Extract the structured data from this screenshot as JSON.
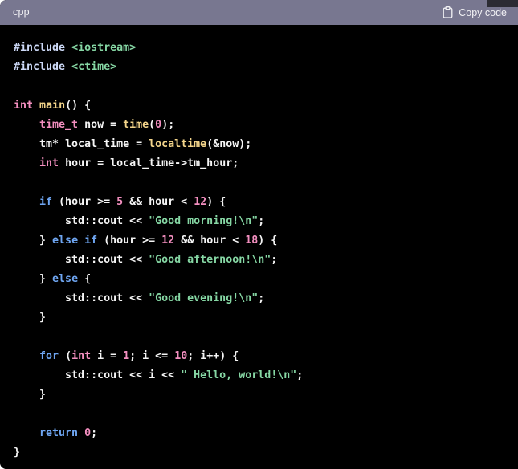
{
  "header": {
    "language_label": "cpp",
    "copy_label": "Copy code",
    "copy_icon": "clipboard-icon",
    "background_color": "#787790",
    "text_color": "#f2f2f5"
  },
  "editor": {
    "background_color": "#000000",
    "default_text_color": "#f5f5f5",
    "language": "cpp",
    "font_size_px": 13.3,
    "line_height_px": 24,
    "line_count": 22
  },
  "theme": {
    "preprocessor": "#cdd9f7",
    "include_path": "#86d7a4",
    "string": "#86d7a4",
    "type": "#f48fc0",
    "number": "#f48fc0",
    "function": "#f3d48a",
    "keyword": "#6fa6f2",
    "plain": "#f5f5f5"
  },
  "code": {
    "plain_text": "#include <iostream>\n#include <ctime>\n\nint main() {\n    time_t now = time(0);\n    tm* local_time = localtime(&now);\n    int hour = local_time->tm_hour;\n\n    if (hour >= 5 && hour < 12) {\n        std::cout << \"Good morning!\\n\";\n    } else if (hour >= 12 && hour < 18) {\n        std::cout << \"Good afternoon!\\n\";\n    } else {\n        std::cout << \"Good evening!\\n\";\n    }\n\n    for (int i = 1; i <= 10; i++) {\n        std::cout << i << \" Hello, world!\\n\";\n    }\n\n    return 0;\n}",
    "lines": [
      {
        "n": 1,
        "tokens": [
          {
            "t": "#include",
            "c": "pre"
          },
          {
            "t": " ",
            "c": "plain"
          },
          {
            "t": "<iostream>",
            "c": "inc"
          }
        ]
      },
      {
        "n": 2,
        "tokens": [
          {
            "t": "#include",
            "c": "pre"
          },
          {
            "t": " ",
            "c": "plain"
          },
          {
            "t": "<ctime>",
            "c": "inc"
          }
        ]
      },
      {
        "n": 3,
        "tokens": []
      },
      {
        "n": 4,
        "tokens": [
          {
            "t": "int",
            "c": "type"
          },
          {
            "t": " ",
            "c": "plain"
          },
          {
            "t": "main",
            "c": "fn"
          },
          {
            "t": "() {",
            "c": "plain"
          }
        ]
      },
      {
        "n": 5,
        "tokens": [
          {
            "t": "    ",
            "c": "plain"
          },
          {
            "t": "time_t",
            "c": "type"
          },
          {
            "t": " now = ",
            "c": "plain"
          },
          {
            "t": "time",
            "c": "fn"
          },
          {
            "t": "(",
            "c": "plain"
          },
          {
            "t": "0",
            "c": "num"
          },
          {
            "t": ");",
            "c": "plain"
          }
        ]
      },
      {
        "n": 6,
        "tokens": [
          {
            "t": "    tm* local_time = ",
            "c": "plain"
          },
          {
            "t": "localtime",
            "c": "fn"
          },
          {
            "t": "(&now);",
            "c": "plain"
          }
        ]
      },
      {
        "n": 7,
        "tokens": [
          {
            "t": "    ",
            "c": "plain"
          },
          {
            "t": "int",
            "c": "type"
          },
          {
            "t": " hour = local_time->tm_hour;",
            "c": "plain"
          }
        ]
      },
      {
        "n": 8,
        "tokens": []
      },
      {
        "n": 9,
        "tokens": [
          {
            "t": "    ",
            "c": "plain"
          },
          {
            "t": "if",
            "c": "kw"
          },
          {
            "t": " (hour >= ",
            "c": "plain"
          },
          {
            "t": "5",
            "c": "num"
          },
          {
            "t": " && hour < ",
            "c": "plain"
          },
          {
            "t": "12",
            "c": "num"
          },
          {
            "t": ") {",
            "c": "plain"
          }
        ]
      },
      {
        "n": 10,
        "tokens": [
          {
            "t": "        std::cout << ",
            "c": "plain"
          },
          {
            "t": "\"Good morning!\\n\"",
            "c": "str"
          },
          {
            "t": ";",
            "c": "plain"
          }
        ]
      },
      {
        "n": 11,
        "tokens": [
          {
            "t": "    } ",
            "c": "plain"
          },
          {
            "t": "else",
            "c": "kw"
          },
          {
            "t": " ",
            "c": "plain"
          },
          {
            "t": "if",
            "c": "kw"
          },
          {
            "t": " (hour >= ",
            "c": "plain"
          },
          {
            "t": "12",
            "c": "num"
          },
          {
            "t": " && hour < ",
            "c": "plain"
          },
          {
            "t": "18",
            "c": "num"
          },
          {
            "t": ") {",
            "c": "plain"
          }
        ]
      },
      {
        "n": 12,
        "tokens": [
          {
            "t": "        std::cout << ",
            "c": "plain"
          },
          {
            "t": "\"Good afternoon!\\n\"",
            "c": "str"
          },
          {
            "t": ";",
            "c": "plain"
          }
        ]
      },
      {
        "n": 13,
        "tokens": [
          {
            "t": "    } ",
            "c": "plain"
          },
          {
            "t": "else",
            "c": "kw"
          },
          {
            "t": " {",
            "c": "plain"
          }
        ]
      },
      {
        "n": 14,
        "tokens": [
          {
            "t": "        std::cout << ",
            "c": "plain"
          },
          {
            "t": "\"Good evening!\\n\"",
            "c": "str"
          },
          {
            "t": ";",
            "c": "plain"
          }
        ]
      },
      {
        "n": 15,
        "tokens": [
          {
            "t": "    }",
            "c": "plain"
          }
        ]
      },
      {
        "n": 16,
        "tokens": []
      },
      {
        "n": 17,
        "tokens": [
          {
            "t": "    ",
            "c": "plain"
          },
          {
            "t": "for",
            "c": "kw"
          },
          {
            "t": " (",
            "c": "plain"
          },
          {
            "t": "int",
            "c": "type"
          },
          {
            "t": " i = ",
            "c": "plain"
          },
          {
            "t": "1",
            "c": "num"
          },
          {
            "t": "; i <= ",
            "c": "plain"
          },
          {
            "t": "10",
            "c": "num"
          },
          {
            "t": "; i++) {",
            "c": "plain"
          }
        ]
      },
      {
        "n": 18,
        "tokens": [
          {
            "t": "        std::cout << i << ",
            "c": "plain"
          },
          {
            "t": "\" Hello, world!\\n\"",
            "c": "str"
          },
          {
            "t": ";",
            "c": "plain"
          }
        ]
      },
      {
        "n": 19,
        "tokens": [
          {
            "t": "    }",
            "c": "plain"
          }
        ]
      },
      {
        "n": 20,
        "tokens": []
      },
      {
        "n": 21,
        "tokens": [
          {
            "t": "    ",
            "c": "plain"
          },
          {
            "t": "return",
            "c": "kw"
          },
          {
            "t": " ",
            "c": "plain"
          },
          {
            "t": "0",
            "c": "num"
          },
          {
            "t": ";",
            "c": "plain"
          }
        ]
      },
      {
        "n": 22,
        "tokens": [
          {
            "t": "}",
            "c": "plain"
          }
        ]
      }
    ]
  }
}
